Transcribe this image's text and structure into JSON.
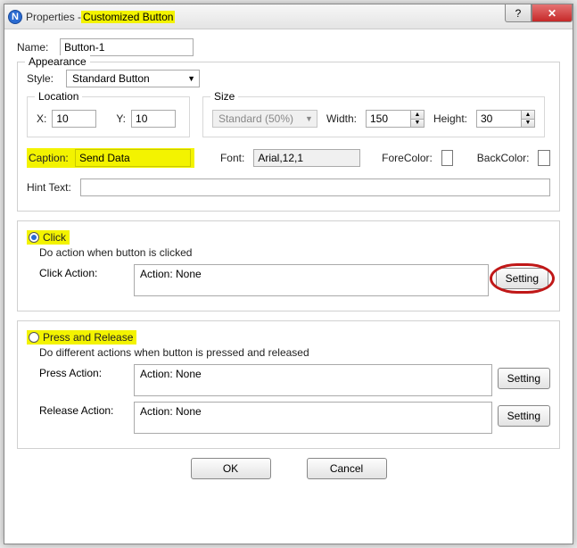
{
  "window": {
    "title_prefix": "Properties - ",
    "title_main": "Customized Button",
    "help_glyph": "?",
    "close_glyph": "✕",
    "app_icon_letter": "N"
  },
  "name": {
    "label": "Name:",
    "value": "Button-1"
  },
  "appearance": {
    "legend": "Appearance",
    "style_label": "Style:",
    "style_value": "Standard Button",
    "location": {
      "legend": "Location",
      "x_label": "X:",
      "x_value": "10",
      "y_label": "Y:",
      "y_value": "10"
    },
    "size": {
      "legend": "Size",
      "preset_value": "Standard  (50%)",
      "width_label": "Width:",
      "width_value": "150",
      "height_label": "Height:",
      "height_value": "30"
    },
    "caption": {
      "label": "Caption:",
      "value": "Send Data"
    },
    "font": {
      "label": "Font:",
      "value": "Arial,12,1"
    },
    "forecolor_label": "ForeColor:",
    "forecolor_value": "#000000",
    "backcolor_label": "BackColor:",
    "backcolor_value": "#ffffff",
    "hint_label": "Hint Text:",
    "hint_value": ""
  },
  "click": {
    "radio_label": "Click",
    "desc": "Do action when button is clicked",
    "action_label": "Click Action:",
    "action_value": "Action: None",
    "setting_btn": "Setting"
  },
  "press": {
    "radio_label": "Press and Release",
    "desc": "Do different actions when button is pressed and released",
    "press_label": "Press Action:",
    "press_value": "Action: None",
    "release_label": "Release Action:",
    "release_value": "Action: None",
    "setting_btn": "Setting"
  },
  "footer": {
    "ok": "OK",
    "cancel": "Cancel"
  }
}
